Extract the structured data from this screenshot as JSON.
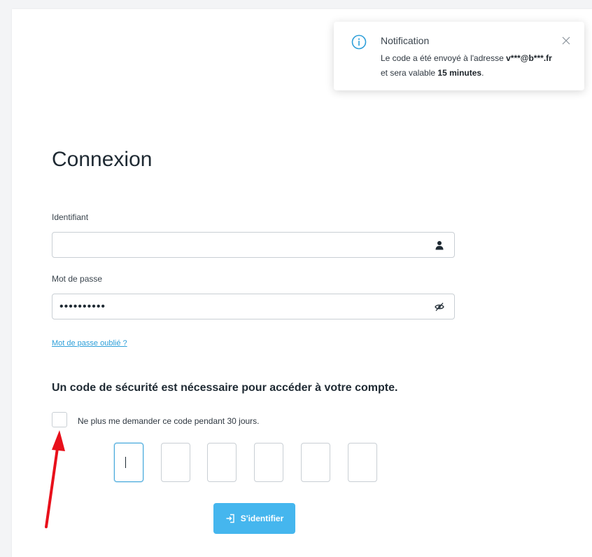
{
  "notification": {
    "title": "Notification",
    "line1_prefix": "Le code a été envoyé à l'adresse ",
    "email": "v***@b***.fr",
    "line2_prefix": "et sera valable ",
    "duration": "15 minutes",
    "line2_suffix": ".",
    "icon": "info-circle-icon",
    "close_icon": "close-icon"
  },
  "form": {
    "title": "Connexion",
    "username": {
      "label": "Identifiant",
      "value": "",
      "icon": "user-icon"
    },
    "password": {
      "label": "Mot de passe",
      "value": "••••••••••",
      "icon": "eye-slash-icon"
    },
    "forgot_link": "Mot de passe oublié ?",
    "security_message": "Un code de sécurité est nécessaire pour accéder à votre compte.",
    "remember_checkbox": {
      "label": "Ne plus me demander ce code pendant 30 jours.",
      "checked": false
    },
    "code_digits": [
      "",
      "",
      "",
      "",
      "",
      ""
    ],
    "submit_label": "S'identifier",
    "submit_icon": "login-icon"
  },
  "colors": {
    "accent": "#45b6ee",
    "link": "#2e9fd9",
    "annotation_arrow": "#e8101b"
  }
}
